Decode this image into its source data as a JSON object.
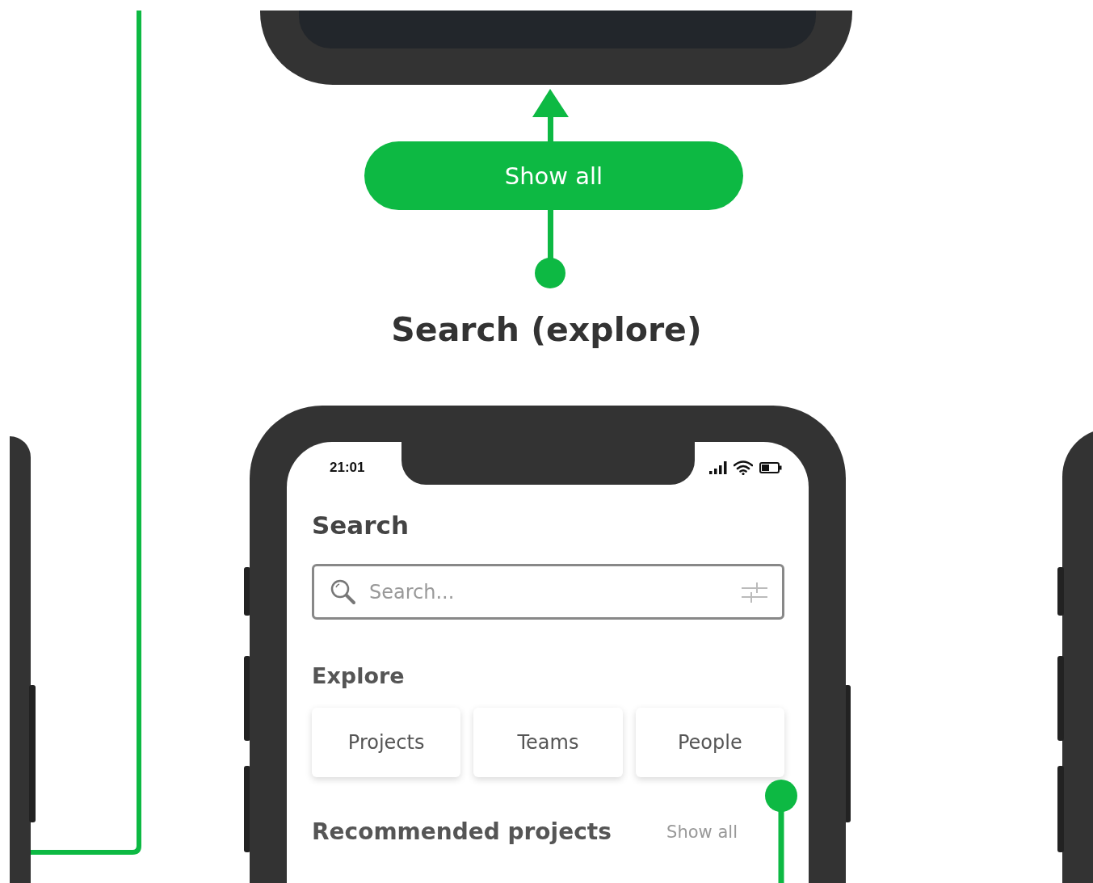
{
  "flow_button": {
    "label": "Show all"
  },
  "screen_title": "Search (explore)",
  "phone": {
    "status_bar": {
      "time": "21:01"
    },
    "title": "Search",
    "search": {
      "placeholder": "Search..."
    },
    "explore": {
      "heading": "Explore",
      "categories": [
        {
          "label": "Projects"
        },
        {
          "label": "Teams"
        },
        {
          "label": "People"
        }
      ]
    },
    "recommended": {
      "heading": "Recommended projects",
      "link": "Show all"
    }
  }
}
